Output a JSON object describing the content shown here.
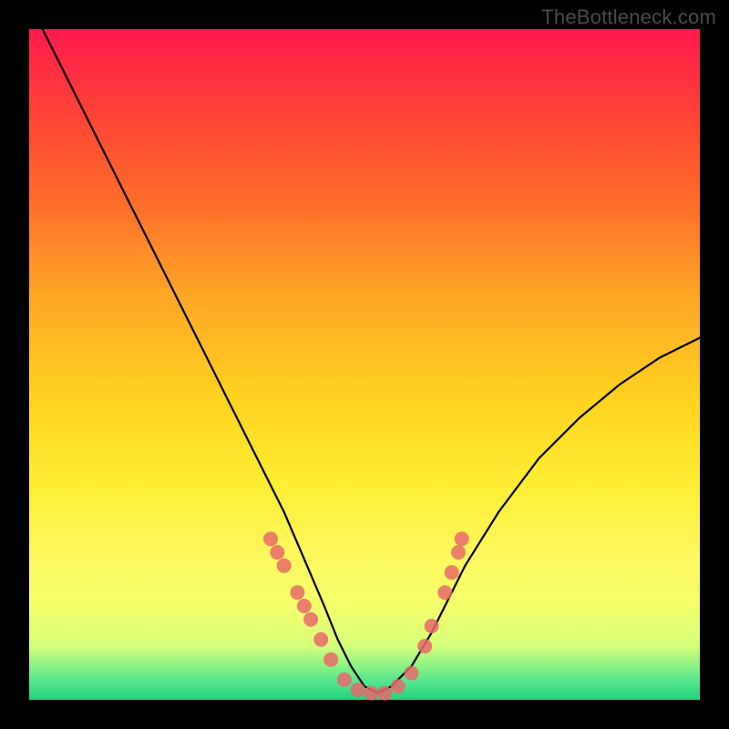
{
  "watermark": "TheBottleneck.com",
  "chart_data": {
    "type": "line",
    "title": "",
    "xlabel": "",
    "ylabel": "",
    "xlim": [
      0,
      100
    ],
    "ylim": [
      0,
      100
    ],
    "grid": false,
    "legend": false,
    "series": [
      {
        "name": "bottleneck-curve",
        "x": [
          2,
          6,
          10,
          14,
          18,
          22,
          26,
          30,
          34,
          38,
          41,
          44,
          46,
          48,
          50,
          52,
          54,
          57,
          60,
          62,
          65,
          70,
          76,
          82,
          88,
          94,
          100
        ],
        "values": [
          100,
          92,
          84,
          76,
          68,
          60,
          52,
          44,
          36,
          28,
          21,
          14,
          9,
          5,
          2,
          1,
          2,
          5,
          10,
          14,
          20,
          28,
          36,
          42,
          47,
          51,
          54
        ]
      }
    ],
    "markers": [
      {
        "name": "left-cluster-1",
        "x": 36,
        "y": 24
      },
      {
        "name": "left-cluster-2",
        "x": 37,
        "y": 22
      },
      {
        "name": "left-cluster-3",
        "x": 38,
        "y": 20
      },
      {
        "name": "left-cluster-4",
        "x": 40,
        "y": 16
      },
      {
        "name": "left-cluster-5",
        "x": 41,
        "y": 14
      },
      {
        "name": "left-cluster-6",
        "x": 42,
        "y": 12
      },
      {
        "name": "left-cluster-7",
        "x": 43.5,
        "y": 9
      },
      {
        "name": "left-cluster-8",
        "x": 45,
        "y": 6
      },
      {
        "name": "bottom-1",
        "x": 47,
        "y": 3
      },
      {
        "name": "bottom-2",
        "x": 49,
        "y": 1.5
      },
      {
        "name": "bottom-3",
        "x": 51,
        "y": 1
      },
      {
        "name": "bottom-4",
        "x": 53,
        "y": 1
      },
      {
        "name": "bottom-5",
        "x": 55,
        "y": 2
      },
      {
        "name": "bottom-6",
        "x": 57,
        "y": 4
      },
      {
        "name": "right-cluster-1",
        "x": 59,
        "y": 8
      },
      {
        "name": "right-cluster-2",
        "x": 60,
        "y": 11
      },
      {
        "name": "right-cluster-3",
        "x": 62,
        "y": 16
      },
      {
        "name": "right-cluster-4",
        "x": 63,
        "y": 19
      },
      {
        "name": "right-cluster-5",
        "x": 64,
        "y": 22
      },
      {
        "name": "right-cluster-6",
        "x": 64.5,
        "y": 24
      }
    ],
    "marker_style": {
      "color": "#e86a6a",
      "radius_px": 8
    }
  }
}
